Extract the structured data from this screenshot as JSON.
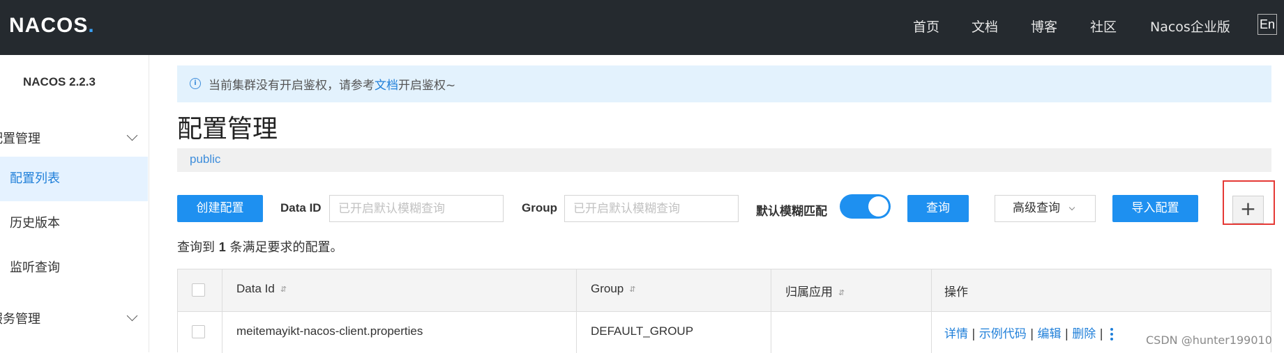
{
  "app": {
    "logo_text": "NACOS",
    "logo_dot": ".",
    "version": "NACOS 2.2.3"
  },
  "topnav": {
    "items": [
      "首页",
      "文档",
      "博客",
      "社区",
      "Nacos企业版"
    ],
    "lang": "En"
  },
  "sidebar": {
    "groups": [
      {
        "label": "配置管理"
      },
      {
        "label": "服务管理"
      }
    ],
    "items": [
      {
        "label": "配置列表",
        "active": true
      },
      {
        "label": "历史版本",
        "active": false
      },
      {
        "label": "监听查询",
        "active": false
      }
    ]
  },
  "notice": {
    "prefix": "当前集群没有开启鉴权，请参考",
    "link": "文档",
    "suffix": "开启鉴权~",
    "icon": "info-icon"
  },
  "page": {
    "title": "配置管理",
    "namespace": "public"
  },
  "toolbar": {
    "create_label": "创建配置",
    "dataid_label": "Data ID",
    "dataid_placeholder": "已开启默认模糊查询",
    "group_label": "Group",
    "group_placeholder": "已开启默认模糊查询",
    "fuzzy_label": "默认模糊匹配",
    "fuzzy_on": true,
    "query_label": "查询",
    "advanced_label": "高级查询",
    "import_label": "导入配置",
    "plus_label": "+"
  },
  "result": {
    "prefix": "查询到",
    "count": "1",
    "suffix": "条满足要求的配置。"
  },
  "table": {
    "headers": [
      "Data Id",
      "Group",
      "归属应用",
      "操作"
    ],
    "rows": [
      {
        "data_id": "meitemayikt-nacos-client.properties",
        "group": "DEFAULT_GROUP",
        "app": "",
        "ops": [
          "详情",
          "示例代码",
          "编辑",
          "删除"
        ]
      }
    ]
  },
  "watermark": "CSDN @hunter199010",
  "colors": {
    "topbar": "#252a2f",
    "primary": "#1e90f0",
    "link": "#1f7fd9",
    "highlight": "#e53935"
  }
}
